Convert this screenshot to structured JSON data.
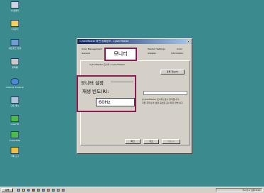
{
  "desktop": {
    "icons": [
      {
        "label": "내 컴퓨터",
        "icon": "computer-icon"
      },
      {
        "label": "내 문서",
        "icon": "documents-icon"
      },
      {
        "label": "네트워크 환경",
        "icon": "network-icon"
      },
      {
        "label": "휴지통",
        "icon": "recycle-bin-icon"
      },
      {
        "label": "Internet Explorer",
        "icon": "internet-explorer-icon"
      },
      {
        "label": "단축 메뉴",
        "icon": "shortcut-icon"
      },
      {
        "label": "CuteFTP",
        "icon": "ftp-icon"
      },
      {
        "label": "CuteHTML",
        "icon": "html-editor-icon"
      },
      {
        "label": "기록 도구",
        "icon": "folder-icon"
      }
    ]
  },
  "dialog": {
    "title": "CyberMaster 화면 등록정보 - CyberMaster",
    "close": "×",
    "tabs": [
      "Color Management",
      "Monitor",
      "Monitor Settings",
      "Color",
      "General",
      "Adapter",
      "Information"
    ],
    "monitor_name": "CyberMaster 모니터 / CyberMaster",
    "properties_button": "등록 정보(P)",
    "info_lines": [
      "[CyberMaster 모니터] 표시 방식입니다.",
      "다른 주파수의 설정 옵션은 표시되지 않습니다.",
      "이 모니터가 표시할 수 없는 모드 숨기기(H)"
    ],
    "buttons": {
      "ok": "확인",
      "cancel": "취소",
      "apply": "적용(A)"
    }
  },
  "callouts": {
    "tab_label": "모니터",
    "group_title": "모니터 설정",
    "refresh_label": "재생 빈도(R):",
    "refresh_value": "60Hz"
  },
  "taskbar": {
    "start_label": "시작",
    "tray_text": "가A 한 ♪ 오후 5:00"
  },
  "colors": {
    "desktop": "#3a8a8e",
    "callout_border": "#8b1a52"
  }
}
